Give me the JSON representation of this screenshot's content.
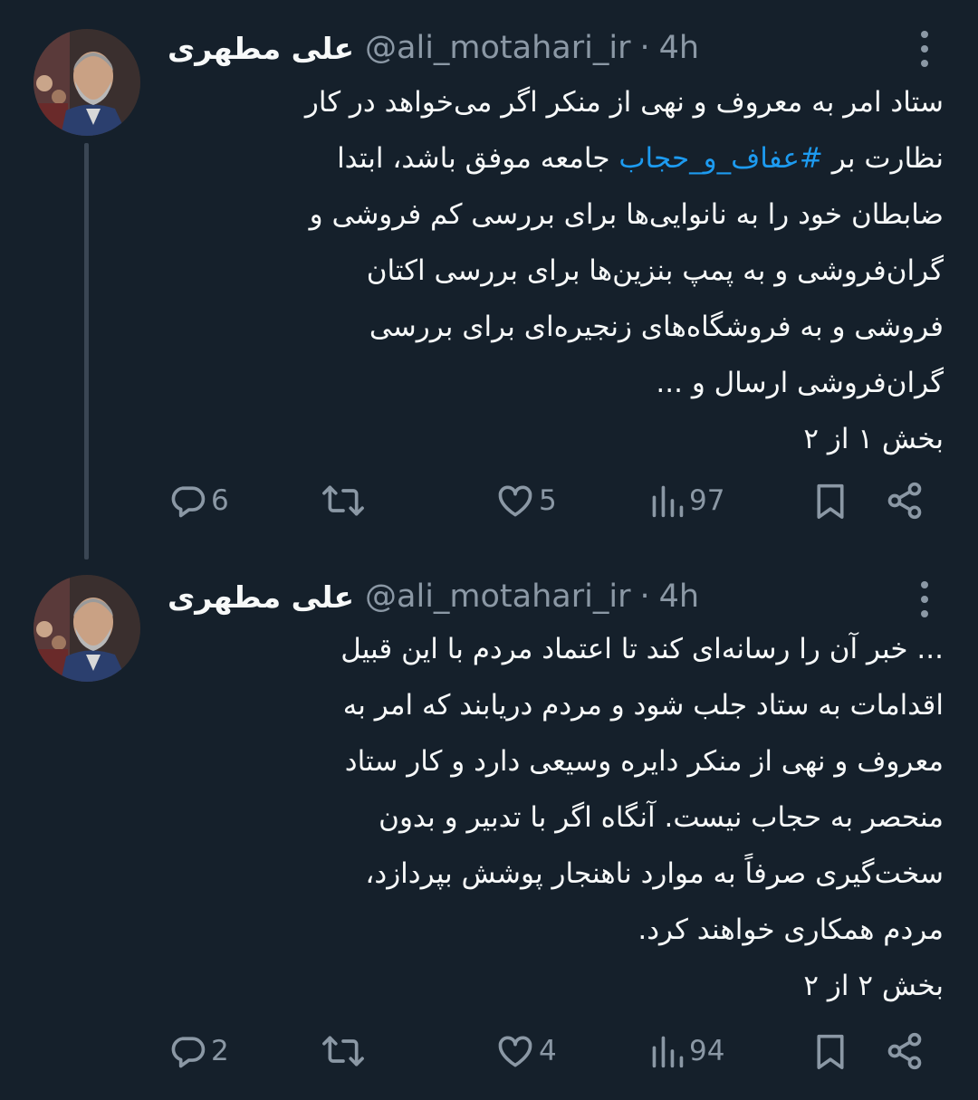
{
  "tweets": [
    {
      "display_name": "علی مطهری",
      "handle": "@ali_motahari_ir",
      "separator": "·",
      "time": "4h",
      "lines": [
        "ستاد امر به معروف و نهی از منکر اگر می‌خواهد در کار",
        "جامعه موفق باشد، ابتدا",
        "ضابطان خود را به نانوایی‌ها برای بررسی کم فروشی و",
        "گران‌فروشی و به پمپ بنزین‌ها برای بررسی اکتان",
        "فروشی و به فروشگاه‌های زنجیره‌ای برای بررسی",
        "گران‌فروشی ارسال و ...",
        "بخش ۱ از ۲"
      ],
      "line2_prefix": "نظارت بر ",
      "hashtag": "#عفاف_و_حجاب",
      "replies": "6",
      "retweets": "",
      "likes": "5",
      "views": "97"
    },
    {
      "display_name": "علی مطهری",
      "handle": "@ali_motahari_ir",
      "separator": "·",
      "time": "4h",
      "lines": [
        "... خبر آن را رسانه‌ای کند تا اعتماد مردم با این قبیل",
        "اقدامات به ستاد جلب شود و مردم دریابند که امر به",
        "معروف و نهی از منکر دایره وسیعی دارد و کار ستاد",
        "منحصر به حجاب نیست. آنگاه اگر با تدبیر و بدون",
        "سخت‌گیری صرفاً به موارد ناهنجار پوشش بپردازد،",
        "مردم همکاری خواهند کرد.",
        "بخش ۲ از ۲"
      ],
      "replies": "2",
      "retweets": "",
      "likes": "4",
      "views": "94"
    }
  ],
  "icons": {
    "reply": "reply-icon",
    "retweet": "retweet-icon",
    "like": "heart-icon",
    "views": "views-icon",
    "bookmark": "bookmark-icon",
    "share": "share-icon",
    "more": "more-vertical-icon"
  },
  "colors": {
    "background": "#15202b",
    "text": "#f7f9f9",
    "secondary": "#8b98a5",
    "link": "#1d9bf0"
  }
}
